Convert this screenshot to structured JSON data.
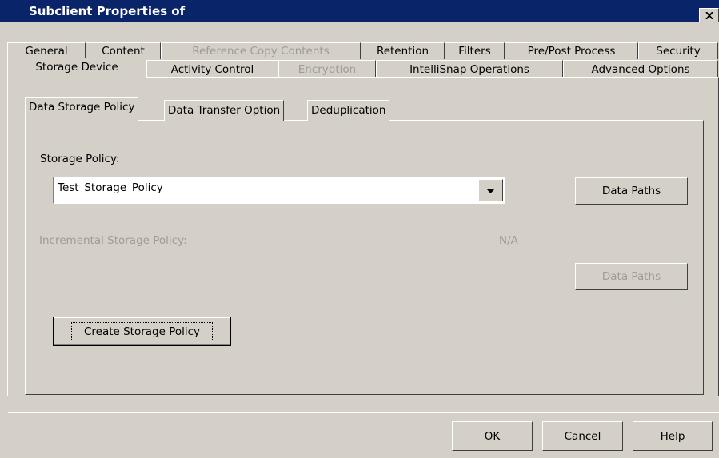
{
  "window": {
    "title": "Subclient Properties of"
  },
  "tabs_row1": [
    {
      "label": "General",
      "disabled": false
    },
    {
      "label": "Content",
      "disabled": false
    },
    {
      "label": "Reference Copy Contents",
      "disabled": true
    },
    {
      "label": "Retention",
      "disabled": false
    },
    {
      "label": "Filters",
      "disabled": false
    },
    {
      "label": "Pre/Post Process",
      "disabled": false
    },
    {
      "label": "Security",
      "disabled": false
    }
  ],
  "tabs_row2": [
    {
      "label": "Storage Device",
      "selected": true
    },
    {
      "label": "Activity Control",
      "disabled": false
    },
    {
      "label": "Encryption",
      "disabled": true
    },
    {
      "label": "IntelliSnap Operations",
      "disabled": false
    },
    {
      "label": "Advanced Options",
      "disabled": false
    }
  ],
  "inner_tabs": [
    {
      "label": "Data Storage Policy",
      "selected": true
    },
    {
      "label": "Data Transfer Option"
    },
    {
      "label": "Deduplication"
    }
  ],
  "storage_policy": {
    "label": "Storage Policy:",
    "value": "Test_Storage_Policy",
    "data_paths_label": "Data Paths"
  },
  "incremental_policy": {
    "label": "Incremental Storage Policy:",
    "value": "N/A",
    "data_paths_label": "Data Paths"
  },
  "create_button_label": "Create Storage Policy",
  "footer": {
    "ok": "OK",
    "cancel": "Cancel",
    "help": "Help"
  }
}
